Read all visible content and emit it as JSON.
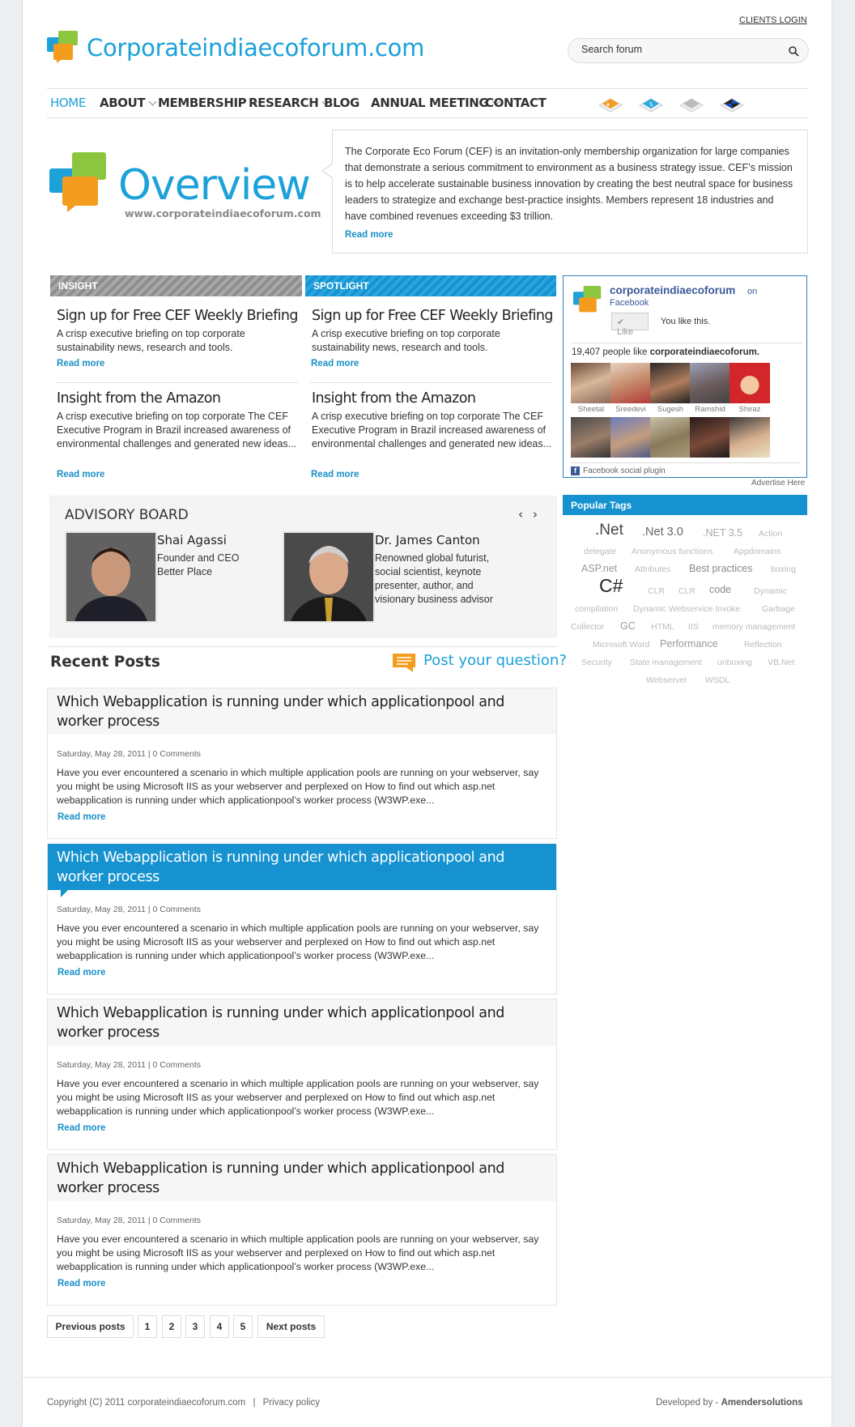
{
  "header": {
    "clients_login": "CLIENTS LOGIN",
    "site_title": "Corporateindiaecoforum.com",
    "search_placeholder": "Search forum"
  },
  "nav": {
    "items": [
      {
        "label": "HOME",
        "active": true
      },
      {
        "label": "ABOUT",
        "dropdown": true
      },
      {
        "label": "MEMBERSHIP",
        "dropdown": true
      },
      {
        "label": "RESEARCH",
        "dropdown": true
      },
      {
        "label": "BLOG"
      },
      {
        "label": "ANNUAL MEETING",
        "dropdown": true
      },
      {
        "label": "CONTACT"
      }
    ],
    "social_icons": [
      "rss-icon",
      "skype-icon",
      "stumbleupon-icon",
      "delicious-icon"
    ]
  },
  "overview": {
    "title": "Overview",
    "url": "www.corporateindiaecoforum.com",
    "text": "The Corporate Eco Forum (CEF) is an invitation-only membership organization for large companies that demonstrate a serious commitment to environment as a business strategy issue. CEF’s mission is to help accelerate sustainable business innovation by creating the best neutral space for business leaders to strategize and exchange best-practice insights. Members represent 18 industries and have combined revenues exceeding $3 trillion.",
    "read_more": "Read more"
  },
  "insight": {
    "heading": "INSIGHT",
    "items": [
      {
        "title": "Sign up for Free CEF Weekly Briefing",
        "desc": "A crisp executive briefing on top corporate sustainability news, research and tools.",
        "read_more": "Read more"
      },
      {
        "title": "Insight from the Amazon",
        "desc": "A crisp executive briefing on top corporate The CEF Executive Program in Brazil increased awareness of environmental challenges and generated new ideas...",
        "read_more": "Read more"
      }
    ]
  },
  "spotlight": {
    "heading": "SPOTLIGHT",
    "items": [
      {
        "title": "Sign up for Free CEF Weekly Briefing",
        "desc": "A crisp executive briefing on top corporate sustainability news, research and tools.",
        "read_more": "Read more"
      },
      {
        "title": "Insight from the Amazon",
        "desc": "A crisp executive briefing on top corporate The CEF Executive Program in Brazil increased awareness of environmental challenges and generated new ideas...",
        "read_more": "Read more"
      }
    ]
  },
  "facebook": {
    "page_name": "corporateindiaecoforum",
    "on": "on",
    "facebook": "Facebook",
    "like_button": "Like",
    "you_like": "You like this.",
    "count_text": "19,407 people like",
    "count_name": "corporateindiaecoforum.",
    "faces": [
      "Sheetal",
      "Sreedevi",
      "Sugesh",
      "Ramshid",
      "Shiraz",
      "",
      "",
      "",
      "",
      ""
    ],
    "plugin_label": "Facebook social plugin",
    "advertise": "Advertise Here"
  },
  "popular_tags": {
    "heading": "Popular Tags",
    "tags": [
      ".Net",
      ".Net 3.0",
      ".NET 3.5",
      "Action",
      "delegate",
      "Anonymous functions",
      "Appdomains",
      "ASP.net",
      "Attributes",
      "Best practices",
      "boxing",
      "C#",
      "CLR",
      "CLR",
      "code",
      "Dynamic",
      "compilation",
      "Dynamic Webservice Invoke",
      "Garbage",
      "Collector",
      "GC",
      "HTML",
      "IIS",
      "memory management",
      "Microsoft Word",
      "Performance",
      "Reflection",
      "Security",
      "State management",
      "unboxing",
      "VB.Net",
      "Webserver",
      "WSDL"
    ]
  },
  "advisory": {
    "title": "ADVISORY BOARD",
    "members": [
      {
        "name": "Shai Agassi",
        "role_lines": [
          "Founder and CEO",
          "Better Place"
        ]
      },
      {
        "name": "Dr. James Canton",
        "role_lines": [
          "Renowned global futurist,",
          "social scientist, keynote",
          "presenter, author, and",
          "visionary business advisor"
        ]
      }
    ]
  },
  "recent_posts": {
    "title": "Recent Posts",
    "ask": "Post your question?",
    "posts": [
      {
        "title": "Which Webapplication is running under which applicationpool and worker process",
        "meta": "Saturday, May 28, 2011 | 0 Comments",
        "body": "Have you ever encountered a scenario in which multiple application pools are running on your webserver, say you might be using Microsoft IIS as your webserver and perplexed on How to find out which asp.net webapplication is running under which applicationpool’s worker process (W3WP.exe...",
        "read_more": "Read more"
      },
      {
        "title": "Which Webapplication is running under which applicationpool and worker process",
        "meta": "Saturday, May 28, 2011 | 0 Comments",
        "body": "Have you ever encountered a scenario in which multiple application pools are running on your webserver, say you might be using Microsoft IIS as your webserver and perplexed on How to find out which asp.net webapplication is running under which applicationpool’s worker process (W3WP.exe...",
        "read_more": "Read more"
      },
      {
        "title": "Which Webapplication is running under which applicationpool and worker process",
        "meta": "Saturday, May 28, 2011 | 0 Comments",
        "body": "Have you ever encountered a scenario in which multiple application pools are running on your webserver, say you might be using Microsoft IIS as your webserver and perplexed on How to find out which asp.net webapplication is running under which applicationpool’s worker process (W3WP.exe...",
        "read_more": "Read more"
      },
      {
        "title": "Which Webapplication is running under which applicationpool and worker process",
        "meta": "Saturday, May 28, 2011 | 0 Comments",
        "body": "Have you ever encountered a scenario in which multiple application pools are running on your webserver, say you might be using Microsoft IIS as your webserver and perplexed on How to find out which asp.net webapplication is running under which applicationpool’s worker process (W3WP.exe...",
        "read_more": "Read more"
      }
    ]
  },
  "pagination": {
    "previous": "Previous posts",
    "pages": [
      "1",
      "2",
      "3",
      "4",
      "5"
    ],
    "next": "Next posts"
  },
  "footer": {
    "copyright": "Copyright (C) 2011 corporateindiaecoforum.com",
    "divider": "|",
    "privacy": "Privacy policy",
    "developed_by": "Developed by -",
    "developer": "Amendersolutions"
  },
  "colors": {
    "brand_blue": "#1ca1d9",
    "header_bar_blue": "#1592cf",
    "insight_gray": "#9a9a9a"
  }
}
